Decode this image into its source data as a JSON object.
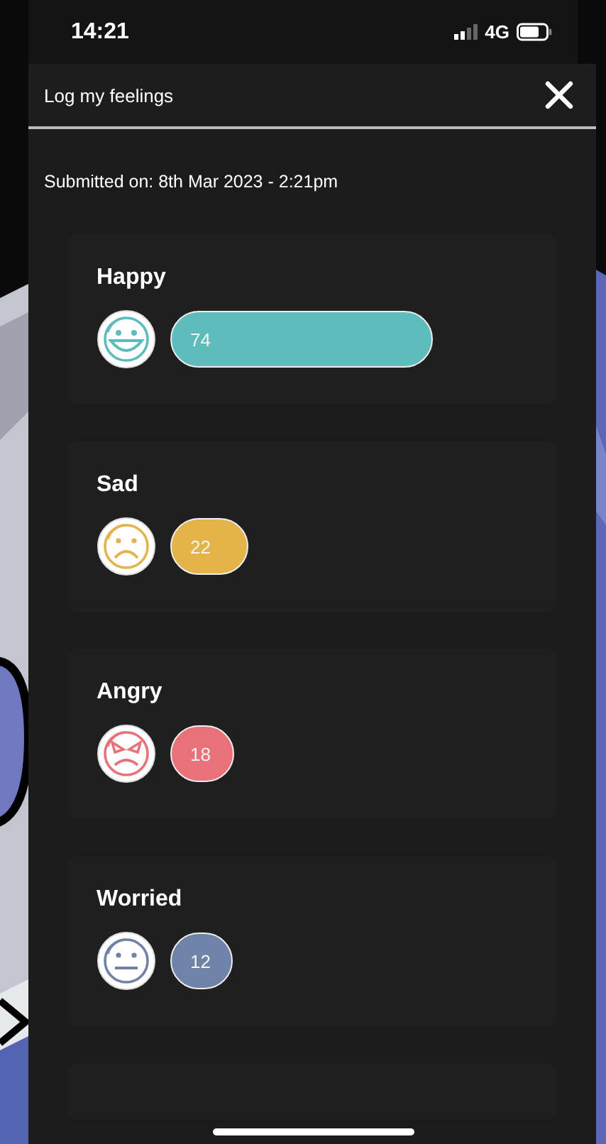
{
  "status_bar": {
    "time": "14:21",
    "network": "4G"
  },
  "header": {
    "title": "Log my feelings"
  },
  "submitted": "Submitted on: 8th Mar 2023 - 2:21pm",
  "feelings": [
    {
      "name": "Happy",
      "kind": "happy",
      "color": "#5fbcbc",
      "value": "74"
    },
    {
      "name": "Sad",
      "kind": "sad",
      "color": "#e3b44a",
      "value": "22"
    },
    {
      "name": "Angry",
      "kind": "angry",
      "color": "#e9727a",
      "value": "18"
    },
    {
      "name": "Worried",
      "kind": "worried",
      "color": "#6f83a8",
      "value": "12"
    }
  ]
}
